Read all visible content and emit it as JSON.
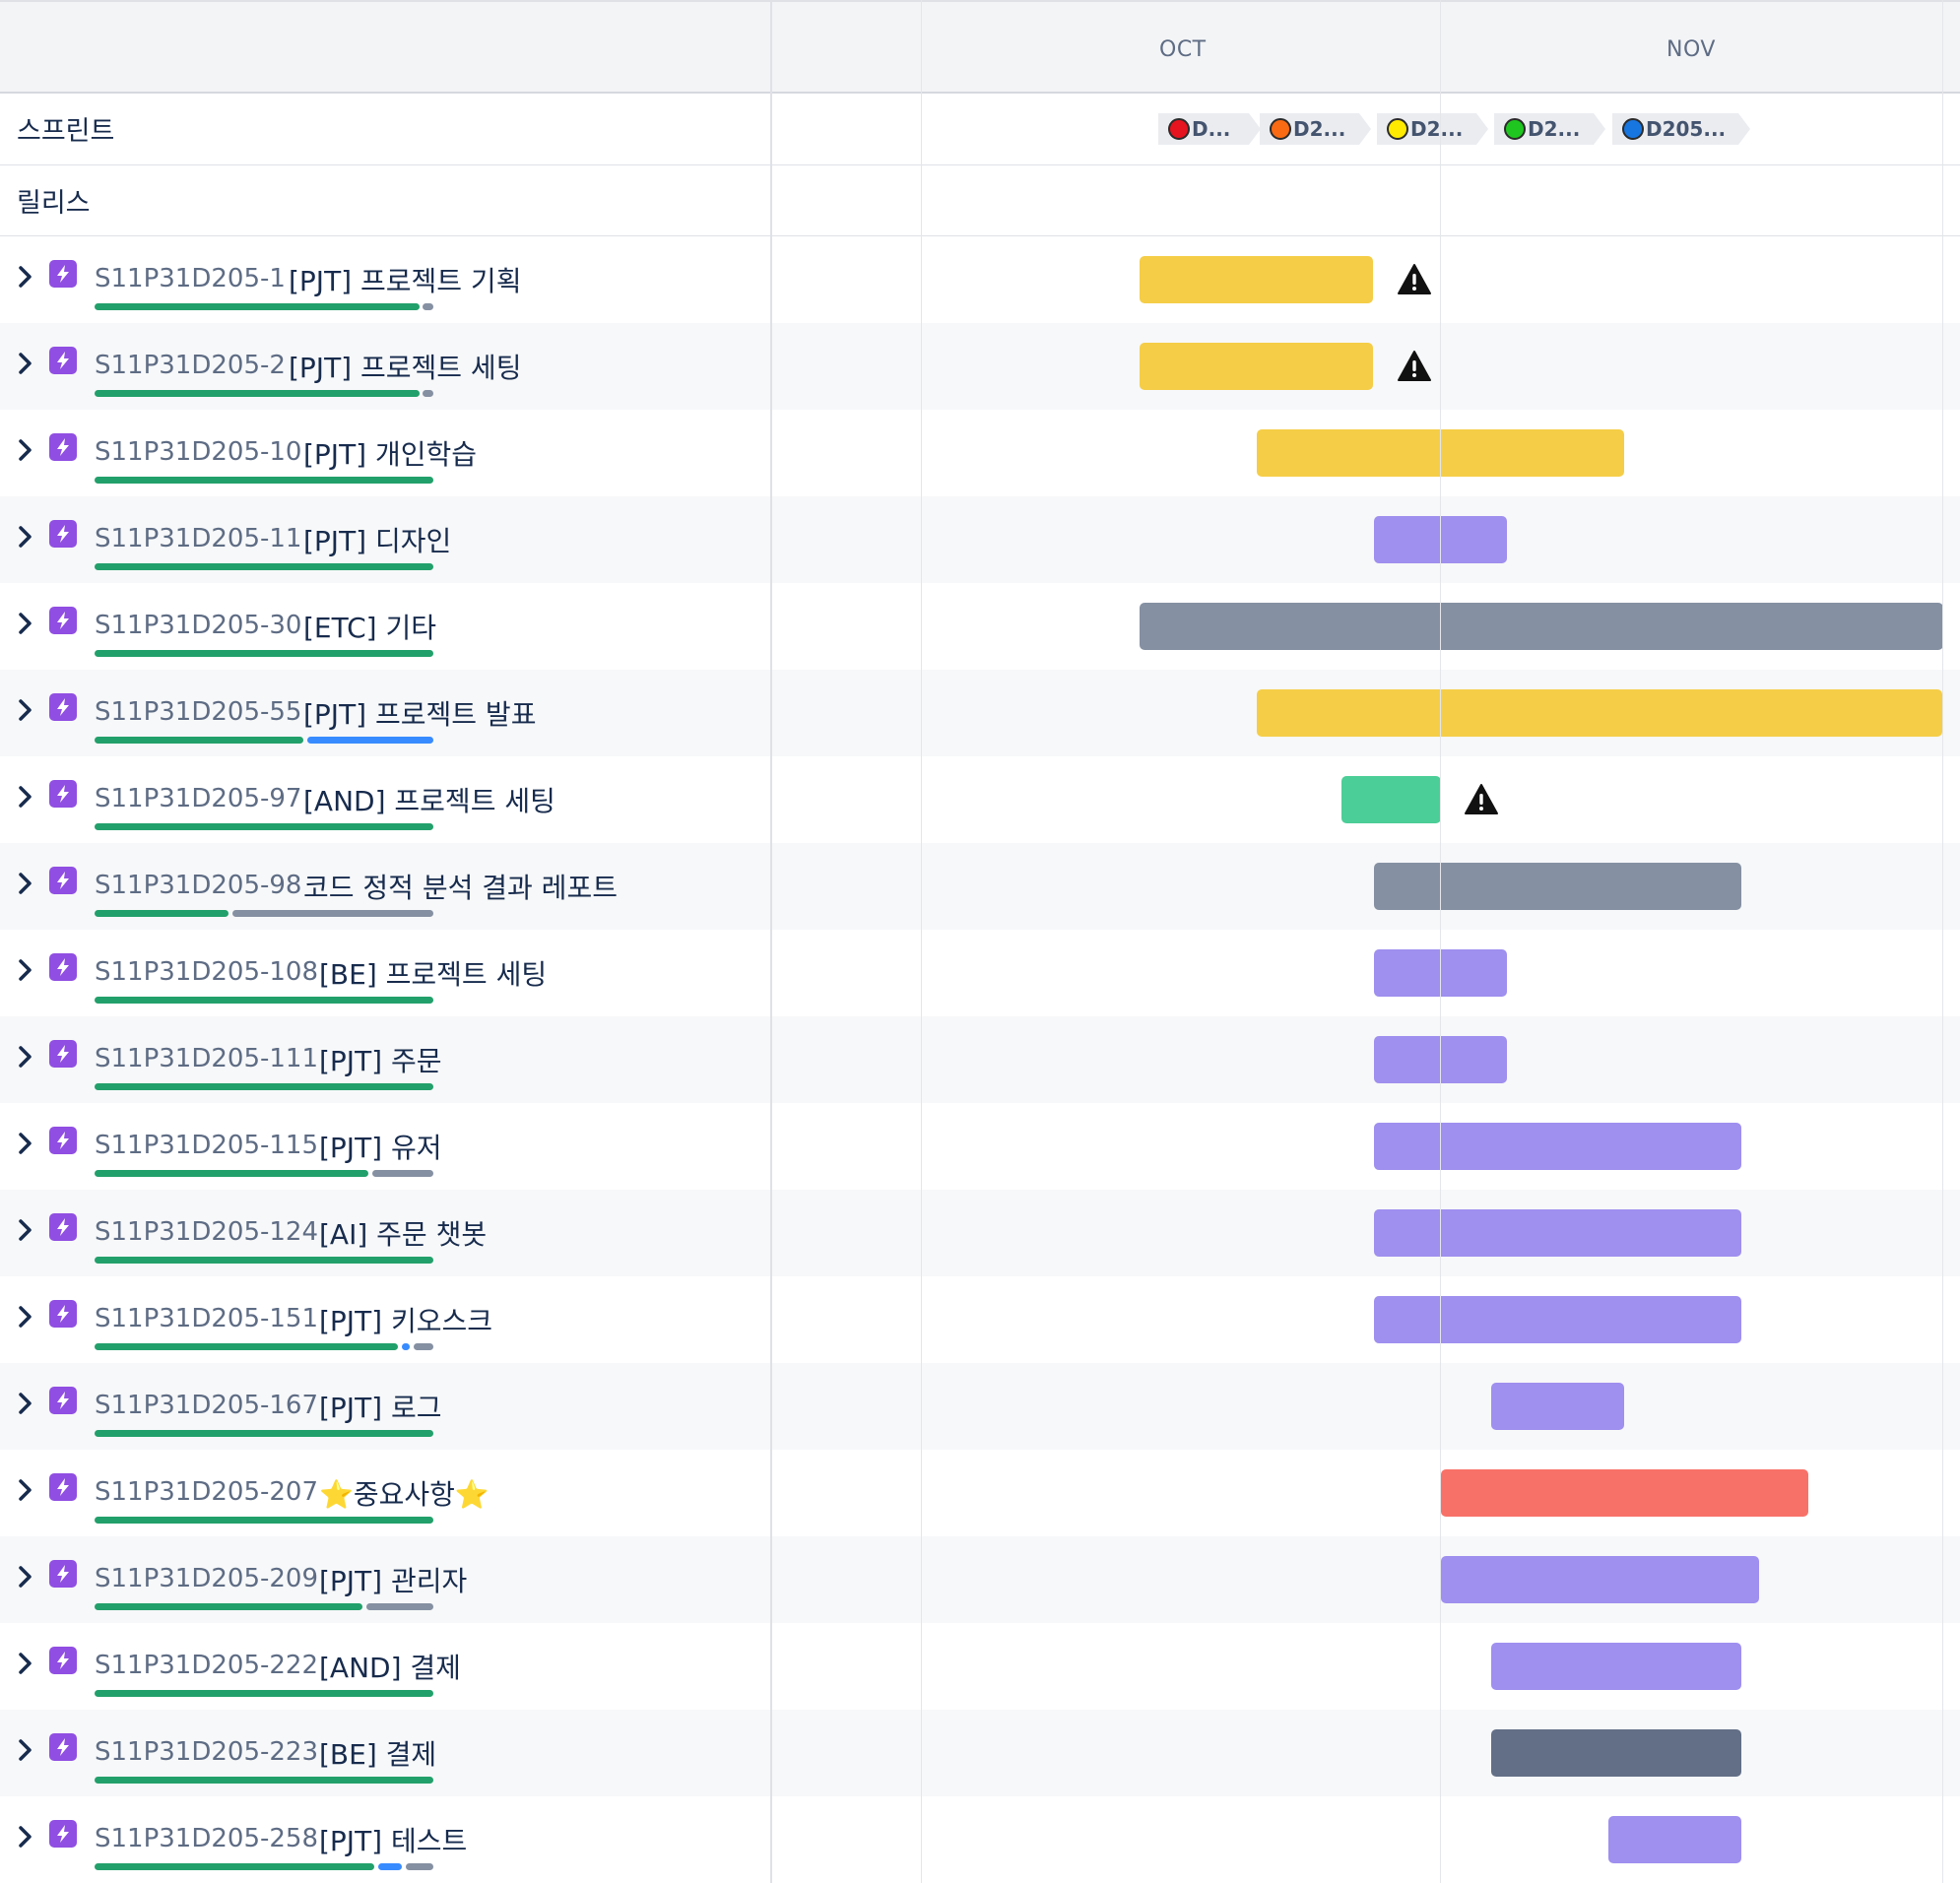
{
  "header": {
    "months": [
      "OCT",
      "NOV"
    ]
  },
  "fixed_rows": {
    "sprint_label": "스프린트",
    "release_label": "릴리스"
  },
  "sprints": [
    {
      "label": "D...",
      "color": "#e5141e"
    },
    {
      "label": "D2...",
      "color": "#f96a12"
    },
    {
      "label": "D2...",
      "color": "#ffea00"
    },
    {
      "label": "D2...",
      "color": "#1fc61f"
    },
    {
      "label": "D205...",
      "color": "#1876e0"
    }
  ],
  "colors": {
    "yellow": "#f5cd47",
    "purple": "#9f8fef",
    "gray": "#8590a2",
    "teal": "#4bce97",
    "red": "#f87168",
    "slate": "#626f86",
    "progress_done": "#22a06b",
    "progress_inprogress": "#388bff",
    "progress_todo": "#8590a2",
    "epic_icon": "#904ee2"
  },
  "issues": [
    {
      "key": "S11P31D205-1",
      "title": "[PJT] 프로젝트 기획",
      "bar_color": "yellow",
      "warning": true
    },
    {
      "key": "S11P31D205-2",
      "title": "[PJT] 프로젝트 세팅",
      "bar_color": "yellow",
      "warning": true
    },
    {
      "key": "S11P31D205-10",
      "title": "[PJT] 개인학습",
      "bar_color": "yellow",
      "warning": false
    },
    {
      "key": "S11P31D205-11",
      "title": "[PJT] 디자인",
      "bar_color": "purple",
      "warning": false
    },
    {
      "key": "S11P31D205-30",
      "title": "[ETC] 기타",
      "bar_color": "gray",
      "warning": false
    },
    {
      "key": "S11P31D205-55",
      "title": "[PJT] 프로젝트 발표",
      "bar_color": "yellow",
      "warning": false
    },
    {
      "key": "S11P31D205-97",
      "title": "[AND] 프로젝트 세팅",
      "bar_color": "teal",
      "warning": true
    },
    {
      "key": "S11P31D205-98",
      "title": "코드 정적 분석 결과 레포트",
      "bar_color": "gray",
      "warning": false
    },
    {
      "key": "S11P31D205-108",
      "title": "[BE] 프로젝트 세팅",
      "bar_color": "purple",
      "warning": false
    },
    {
      "key": "S11P31D205-111",
      "title": "[PJT] 주문",
      "bar_color": "purple",
      "warning": false
    },
    {
      "key": "S11P31D205-115",
      "title": "[PJT] 유저",
      "bar_color": "purple",
      "warning": false
    },
    {
      "key": "S11P31D205-124",
      "title": "[AI] 주문 챗봇",
      "bar_color": "purple",
      "warning": false
    },
    {
      "key": "S11P31D205-151",
      "title": "[PJT] 키오스크",
      "bar_color": "purple",
      "warning": false
    },
    {
      "key": "S11P31D205-167",
      "title": "[PJT] 로그",
      "bar_color": "purple",
      "warning": false
    },
    {
      "key": "S11P31D205-207",
      "title": "⭐중요사항⭐",
      "bar_color": "red",
      "warning": false
    },
    {
      "key": "S11P31D205-209",
      "title": "[PJT] 관리자",
      "bar_color": "purple",
      "warning": false
    },
    {
      "key": "S11P31D205-222",
      "title": "[AND] 결제",
      "bar_color": "purple",
      "warning": false
    },
    {
      "key": "S11P31D205-223",
      "title": "[BE] 결제",
      "bar_color": "slate",
      "warning": false
    },
    {
      "key": "S11P31D205-258",
      "title": "[PJT] 테스트",
      "bar_color": "purple",
      "warning": false
    }
  ]
}
